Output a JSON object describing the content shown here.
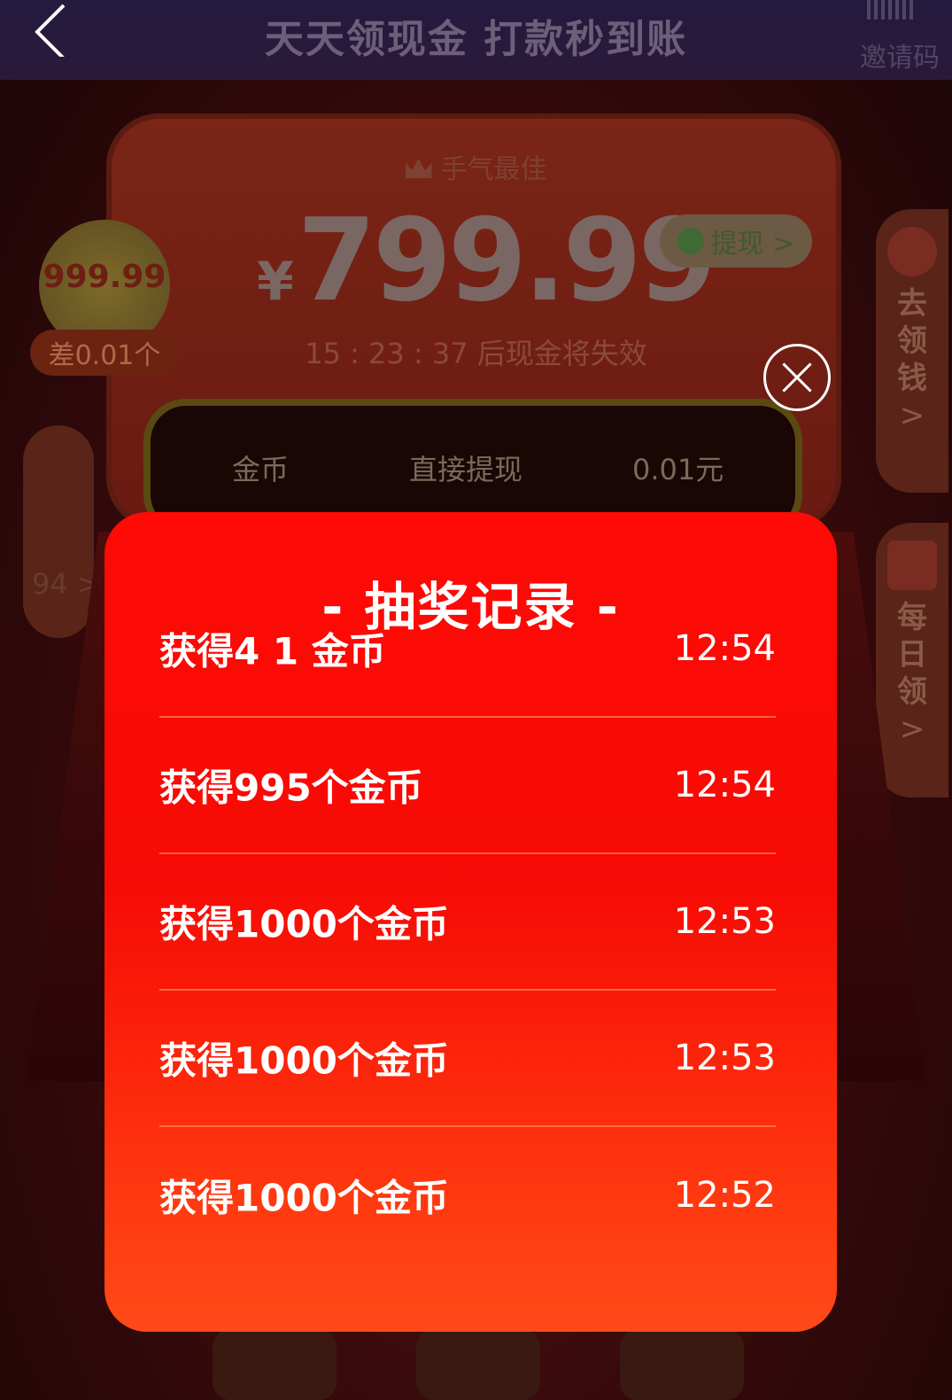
{
  "header": {
    "title": "天天领现金 打款秒到账",
    "invite_label": "邀请码"
  },
  "card": {
    "best_luck": "手气最佳",
    "currency": "¥",
    "amount": "799.99",
    "withdraw_label": "提现 >",
    "countdown": "15 : 23 : 37 后现金将失效"
  },
  "left": {
    "coin_amount": "999.99",
    "diff_label": "差0.01个",
    "side_num": "94 >"
  },
  "right_tabs": [
    {
      "lines": [
        "去",
        "领",
        "钱"
      ],
      "chevron": ">"
    },
    {
      "lines": [
        "每",
        "日",
        "领"
      ],
      "chevron": ">"
    }
  ],
  "table_header": {
    "col1": "金币",
    "col2": "直接提现",
    "col3": "0.01元"
  },
  "modal": {
    "title": "- 抽奖记录 -",
    "records": [
      {
        "text": "获得4 1 金币",
        "time": "12:54"
      },
      {
        "text": "获得995个金币",
        "time": "12:54"
      },
      {
        "text": "获得1000个金币",
        "time": "12:53"
      },
      {
        "text": "获得1000个金币",
        "time": "12:53"
      },
      {
        "text": "获得1000个金币",
        "time": "12:52"
      }
    ]
  },
  "colors": {
    "modal_top": "#ff0a06",
    "modal_bottom": "#ff4a18",
    "text": "#ffffff"
  }
}
